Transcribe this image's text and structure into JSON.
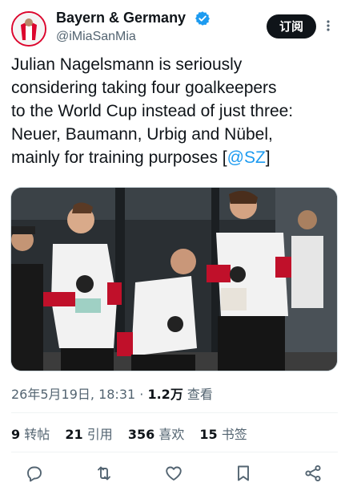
{
  "account": {
    "name": "Bayern & Germany",
    "handle": "@iMiaSanMia",
    "follow_label": "订阅"
  },
  "tweet": {
    "text_lines": [
      "Julian Nagelsmann is seriously",
      "considering taking four goalkeepers",
      "to the World Cup instead of just three:",
      "Neuer, Baumann, Urbig and Nübel,",
      "mainly for training purposes ["
    ],
    "link_text": "@SZ",
    "closing": "]",
    "photo_alt": "Goalkeepers in white Germany training kits"
  },
  "meta": {
    "timestamp": "26年5月19日, 18:31",
    "separator": "·",
    "views_count": "1.2万",
    "views_label": "查看"
  },
  "stats": [
    {
      "count": "9",
      "label": "转帖"
    },
    {
      "count": "21",
      "label": "引用"
    },
    {
      "count": "356",
      "label": "喜欢"
    },
    {
      "count": "15",
      "label": "书签"
    }
  ],
  "icons": {
    "verified": "verified-badge-icon",
    "more": "more-icon",
    "reply": "reply-icon",
    "retweet": "retweet-icon",
    "like": "like-icon",
    "bookmark": "bookmark-icon",
    "share": "share-icon"
  },
  "colors": {
    "accent": "#1d9bf0",
    "text": "#0f1419",
    "muted": "#536471",
    "button": "#0f1419"
  }
}
